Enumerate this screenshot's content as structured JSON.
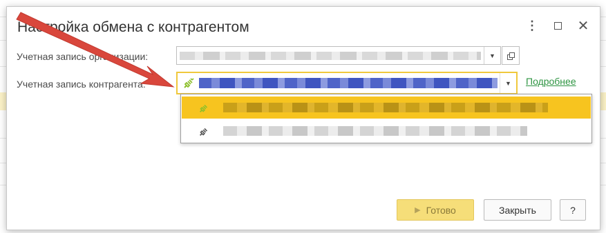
{
  "dialog": {
    "title": "Настройка обмена с контрагентом",
    "controls": {
      "menu_icon": "more-vertical-icon",
      "maximize_icon": "maximize-icon",
      "close_icon": "close-icon"
    }
  },
  "form": {
    "org_account_label": "Учетная запись организации:",
    "counterparty_account_label": "Учетная запись контрагента:",
    "more_link": "Подробнее"
  },
  "dropdown": {
    "items": [
      {
        "icon": "plug-connected-icon",
        "selected": true
      },
      {
        "icon": "plug-icon",
        "selected": false
      }
    ]
  },
  "footer": {
    "done_label": "Готово",
    "close_label": "Закрыть",
    "help_label": "?"
  },
  "colors": {
    "accent_yellow": "#f7c41f",
    "link_green": "#2d9441",
    "arrow_red": "#d9473c"
  }
}
